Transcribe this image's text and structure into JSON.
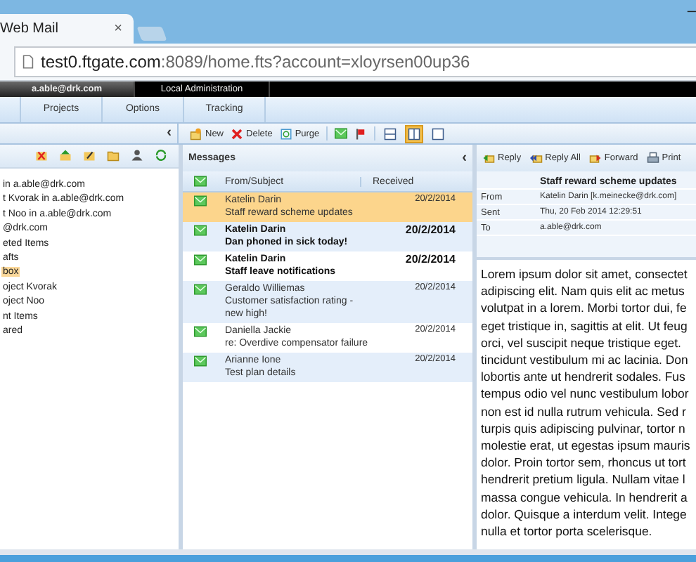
{
  "browser": {
    "tab_title": "Web Mail",
    "tab_close": "×",
    "minimize": "–",
    "address_host": "test0.ftgate.com",
    "address_rest": ":8089/home.fts?account=xloyrsen00up36"
  },
  "accounts": [
    {
      "label": "a.able@drk.com",
      "selected": true
    },
    {
      "label": "Local Administration",
      "selected": false
    }
  ],
  "menu_tabs": [
    "Projects",
    "Options",
    "Tracking"
  ],
  "folders_collapse": "‹",
  "toolbar": {
    "buttons": [
      {
        "label": "New",
        "kind": "new"
      },
      {
        "label": "Delete",
        "kind": "delete"
      },
      {
        "label": "Purge",
        "kind": "purge"
      }
    ],
    "layouts": [
      {
        "kind": "horizontal",
        "selected": false
      },
      {
        "kind": "vertical",
        "selected": true
      },
      {
        "kind": "none",
        "selected": false
      }
    ]
  },
  "folders": [
    {
      "label": "in a.able@drk.com",
      "selected": false
    },
    {
      "label": "t Kvorak in a.able@drk.com",
      "selected": false
    },
    {
      "label": "t Noo in a.able@drk.com",
      "selected": false
    },
    {
      "label": "@drk.com",
      "selected": false
    },
    {
      "label": "eted Items",
      "selected": false
    },
    {
      "label": "afts",
      "selected": false
    },
    {
      "label": "box",
      "selected": true
    },
    {
      "label": "oject Kvorak",
      "selected": false
    },
    {
      "label": "oject Noo",
      "selected": false
    },
    {
      "label": "nt Items",
      "selected": false
    },
    {
      "label": "ared",
      "selected": false
    }
  ],
  "messages": {
    "title": "Messages",
    "collapse": "‹",
    "columns": [
      "From/Subject",
      "Received"
    ],
    "rows": [
      {
        "from": "Katelin Darin",
        "subject": "Staff reward scheme updates",
        "received": "20/2/2014",
        "selected": true,
        "unread": false
      },
      {
        "from": "Katelin Darin",
        "subject": "Dan phoned in sick today!",
        "received": "20/2/2014",
        "selected": false,
        "unread": true
      },
      {
        "from": "Katelin Darin",
        "subject": "Staff leave notifications",
        "received": "20/2/2014",
        "selected": false,
        "unread": true
      },
      {
        "from": "Geraldo Williemas",
        "subject": "Customer satisfaction rating - new high!",
        "received": "20/2/2014",
        "selected": false,
        "unread": false
      },
      {
        "from": "Daniella Jackie",
        "subject": "re: Overdive compensator failure",
        "received": "20/2/2014",
        "selected": false,
        "unread": false
      },
      {
        "from": "Arianne Ione",
        "subject": "Test plan details",
        "received": "20/2/2014",
        "selected": false,
        "unread": false
      }
    ]
  },
  "reading": {
    "actions": [
      {
        "label": "Reply",
        "kind": "reply"
      },
      {
        "label": "Reply All",
        "kind": "replyall"
      },
      {
        "label": "Forward",
        "kind": "forward"
      },
      {
        "label": "Print",
        "kind": "print"
      }
    ],
    "subject": "Staff reward scheme updates",
    "fields": [
      {
        "label": "From",
        "value": "Katelin Darin  [k.meinecke@drk.com]"
      },
      {
        "label": "Sent",
        "value": "Thu, 20 Feb 2014 12:29:51"
      },
      {
        "label": "To",
        "value": "a.able@drk.com"
      }
    ],
    "body_lines": [
      "Lorem ipsum dolor sit amet, consectet",
      "adipiscing elit. Nam quis elit ac metus",
      "volutpat in a lorem. Morbi tortor dui, fe",
      "eget tristique in, sagittis at elit. Ut feug",
      "orci, vel suscipit neque tristique eget.",
      "tincidunt vestibulum mi ac lacinia. Don",
      "lobortis ante ut hendrerit sodales. Fus",
      "tempus odio vel nunc vestibulum lobor",
      "non est id nulla rutrum vehicula. Sed r",
      "turpis quis adipiscing pulvinar, tortor n",
      "molestie erat, ut egestas ipsum mauris",
      "dolor. Proin tortor sem, rhoncus ut tort",
      "hendrerit pretium ligula. Nullam vitae l",
      "massa congue vehicula. In hendrerit a",
      "dolor. Quisque a interdum velit. Intege",
      "nulla et tortor porta scelerisque."
    ]
  }
}
